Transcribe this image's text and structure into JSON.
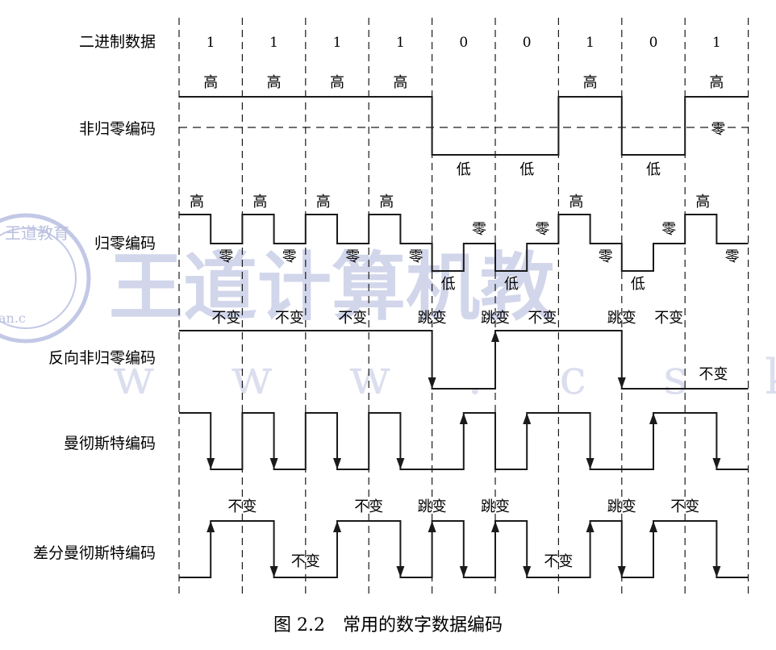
{
  "rows": {
    "binary": "二进制数据",
    "nrz": "非归零编码",
    "rz": "归零编码",
    "nrzi": "反向非归零编码",
    "manchester": "曼彻斯特编码",
    "diff_manchester": "差分曼彻斯特编码"
  },
  "bits": [
    "1",
    "1",
    "1",
    "1",
    "0",
    "0",
    "1",
    "0",
    "1"
  ],
  "terms": {
    "high": "高",
    "low": "低",
    "zero": "零",
    "no_change": "不变",
    "transition": "跳变"
  },
  "caption": "图 2.2　常用的数字数据编码",
  "watermark": {
    "text": "王道计算机教",
    "url": "w w w . c s k a o y a n . c",
    "seal": "王道教育",
    "seal_rim": "an.c"
  },
  "colors": {
    "line": "#1a1a1a",
    "watermark": "#aeb5dc"
  }
}
